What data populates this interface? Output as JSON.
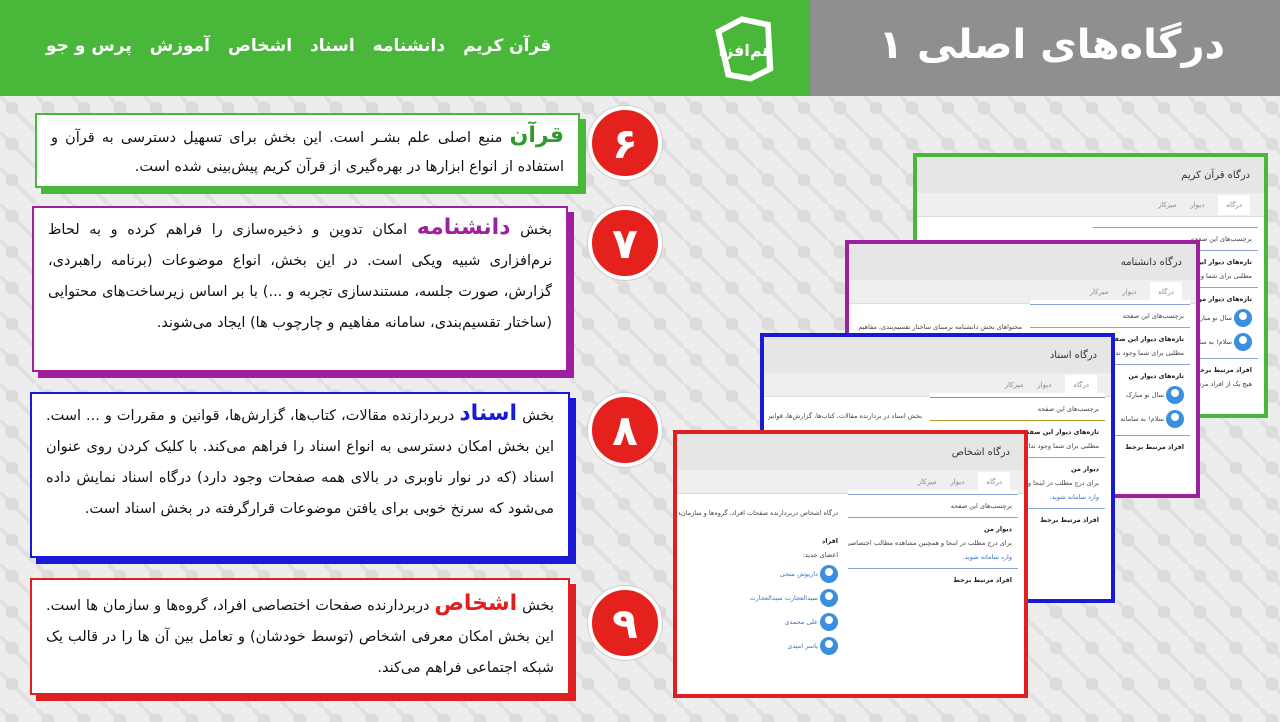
{
  "header": {
    "title": "درگاه‌های اصلی ۱",
    "nav": [
      "قرآن کریم",
      "دانشنامه",
      "اسناد",
      "اشخاص",
      "آموزش",
      "پرس و جو"
    ],
    "logo_text": "هم‌افزا"
  },
  "sections": [
    {
      "number": "۶",
      "keyword": "قرآن",
      "text": " منبع اصلی علم بشـر است. این بخش برای تسهیل دسترسی به قرآن و استفاده از انواع ابزارها در بهره‌گیری از قرآن کریم پیش‌بینی شده است.",
      "prefix": ""
    },
    {
      "number": "۷",
      "prefix": "بخش ",
      "keyword": "دانشنامه",
      "text": " امکان تدوین و ذخیره‌سازی را فراهم کرده و به لحاظ نرم‌افزاری شبیه ویکی است. در این بخش، انواع موضوعات (برنامه راهبردی، گزارش، صورت جلسه، مستندسازی تجربه و ...) با بر اساس زیرساخت‌های محتوایی (ساختار تقسیم‌بندی، سامانه مفاهیم و چارچوب ها) ایجاد می‌شوند."
    },
    {
      "number": "۸",
      "prefix": "بخش ",
      "keyword": "اسناد",
      "text": " دربردارنده مقالات، کتاب‌ها، گزارش‌ها، قوانین و مقررات و ... است. این بخش امکان دسترسی به انواع اسناد را فراهم می‌کند. با کلیک کردن روی عنوان اسناد (که در نوار ناوبری در بالای همه صفحات وجود دارد) درگاه اسناد نمایش داده می‌شود که سرنخ خوبی برای یافتن موضوعات قرارگرفته در بخش اسناد است."
    },
    {
      "number": "۹",
      "prefix": "بخش ",
      "keyword": "اشخاص",
      "text": " دربردارنده صفحات اختصاصی افراد، گروه‌ها و سازمان ها است. این بخش امکان معرفی اشخاص (توسط خودشان) و تعامل بین آن ها را در قالب یک شبکه اجتماعی فراهم می‌کند."
    }
  ],
  "screens": {
    "quran": {
      "title": "درگاه قرآن کریم",
      "tabs": [
        "درگاه",
        "دیوار",
        "میزکار"
      ],
      "side1": "برچسب‌های این صفحه",
      "side2": "تازه‌های دیوار این صفحه",
      "side3": "مطلبی برای شما وجود ندارد",
      "side4": "تازه‌های دیوار من",
      "side5": "سال نو مبارک",
      "side6": "سلام! به سامانه",
      "side7": "افراد مرتبط برخط",
      "side8": "هیچ یک از افراد مرتبط با شما برخط نیستند"
    },
    "danesh": {
      "title": "درگاه دانشنامه",
      "tabs": [
        "درگاه",
        "دیوار",
        "میزکار"
      ],
      "body": "محتواهای بخش دانشنامه برمبنای ساختار تقسیم‌بندی، مفاهیم",
      "side1": "برچسب‌های این صفحه",
      "side2": "تازه‌های دیوار این صفحه",
      "side3": "مطلبی برای شما وجود ندارد",
      "side4": "تازه‌های دیوار من",
      "side5": "سال نو مبارک",
      "side6": "سلام! به سامانه",
      "side7": "افراد مرتبط برخط"
    },
    "asnad": {
      "title": "درگاه اسناد",
      "tabs": [
        "درگاه",
        "دیوار",
        "میزکار"
      ],
      "body": "بخش اسناد در بردارنده مقالات، کتاب‌ها، گزارش‌ها، قوانین و مقررات",
      "side1": "برچسب‌های این صفحه",
      "side2": "تازه‌های دیوار این صفحه",
      "side3": "مطلبی برای شما وجود ندارد",
      "side4": "دیوار من",
      "side5": "برای درج مطلب در اینجا و همچنین",
      "side6": "وارد سامانه شوید.",
      "side7": "افراد مرتبط برخط"
    },
    "ashkhas": {
      "title": "درگاه اشخاص",
      "tabs": [
        "درگاه",
        "دیوار",
        "میزکار"
      ],
      "body": "درگاه اشخاص دربردارنده صفحات افراد، گروه‌ها و سازمان‌ها است",
      "side1": "برچسب‌های این صفحه",
      "side2": "دیوار من",
      "side3": "برای درج مطلب در اینجا و همچنین مشاهده مطالب اختصاصی، باید",
      "side4": "وارد سامانه شوید.",
      "side5": "افراد مرتبط برخط",
      "people_title": "افراد",
      "new_members": "اعضای جدید:",
      "people": [
        "داریوش منجی",
        "سیدالعجارت سیدالعجارت",
        "علی محمدی",
        "یاسر امیدی"
      ]
    }
  }
}
